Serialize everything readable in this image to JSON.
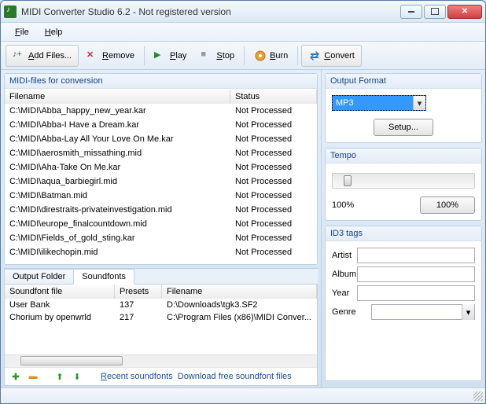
{
  "window": {
    "title": "MIDI Converter Studio 6.2 - Not registered version"
  },
  "menu": {
    "file_u": "F",
    "file_rest": "ile",
    "help_u": "H",
    "help_rest": "elp"
  },
  "toolbar": {
    "add_u": "A",
    "add_rest": "dd Files...",
    "remove_u": "R",
    "remove_rest": "emove",
    "play_u": "P",
    "play_rest": "lay",
    "stop_u": "S",
    "stop_rest": "top",
    "burn_u": "B",
    "burn_rest": "urn",
    "convert_u": "C",
    "convert_rest": "onvert"
  },
  "midi_list": {
    "title": "MIDI-files for conversion",
    "columns": [
      "Filename",
      "Status"
    ],
    "rows": [
      {
        "filename": "C:\\MIDI\\Abba_happy_new_year.kar",
        "status": "Not Processed"
      },
      {
        "filename": "C:\\MIDI\\Abba-I Have a Dream.kar",
        "status": "Not Processed"
      },
      {
        "filename": "C:\\MIDI\\Abba-Lay All Your Love On Me.kar",
        "status": "Not Processed"
      },
      {
        "filename": "C:\\MIDI\\aerosmith_missathing.mid",
        "status": "Not Processed"
      },
      {
        "filename": "C:\\MIDI\\Aha-Take On Me.kar",
        "status": "Not Processed"
      },
      {
        "filename": "C:\\MIDI\\aqua_barbiegirl.mid",
        "status": "Not Processed"
      },
      {
        "filename": "C:\\MIDI\\Batman.mid",
        "status": "Not Processed"
      },
      {
        "filename": "C:\\MIDI\\direstraits-privateinvestigation.mid",
        "status": "Not Processed"
      },
      {
        "filename": "C:\\MIDI\\europe_finalcountdown.mid",
        "status": "Not Processed"
      },
      {
        "filename": "C:\\MIDI\\Fields_of_gold_sting.kar",
        "status": "Not Processed"
      },
      {
        "filename": "C:\\MIDI\\ilikechopin.mid",
        "status": "Not Processed"
      }
    ]
  },
  "tabs": [
    "Output Folder",
    "Soundfonts"
  ],
  "soundfonts": {
    "columns": [
      "Soundfont file",
      "Presets",
      "Filename"
    ],
    "rows": [
      {
        "name": "User Bank",
        "presets": "137",
        "filename": "D:\\Downloads\\tgk3.SF2"
      },
      {
        "name": "Chorium by openwrld",
        "presets": "217",
        "filename": "C:\\Program Files (x86)\\MIDI Conver..."
      }
    ],
    "recent_u": "R",
    "recent_rest": "ecent soundfonts",
    "download_link": "Download free soundfont files"
  },
  "output": {
    "title": "Output Format",
    "format": "MP3",
    "setup_label": "Setup..."
  },
  "tempo": {
    "title": "Tempo",
    "value": "100%",
    "reset_label": "100%"
  },
  "id3": {
    "title": "ID3 tags",
    "artist_label": "Artist",
    "artist": "",
    "album_label": "Album",
    "album": "",
    "year_label": "Year",
    "year": "",
    "genre_label": "Genre",
    "genre": ""
  }
}
